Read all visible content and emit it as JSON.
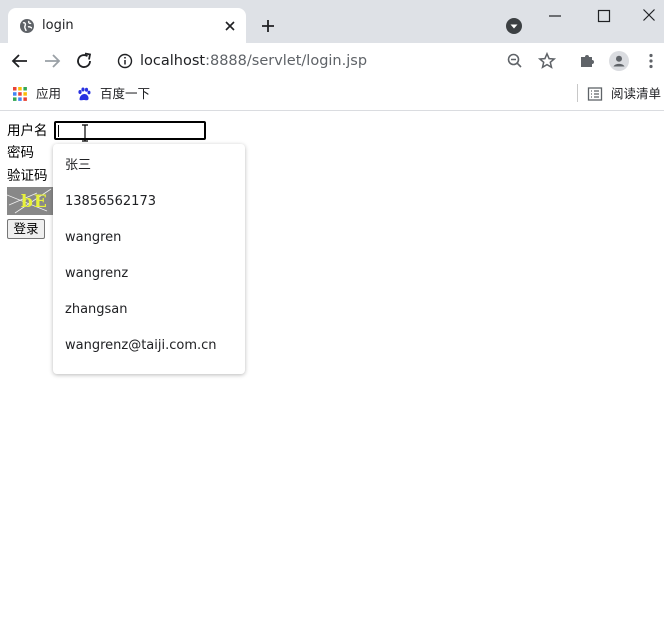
{
  "browser": {
    "tab": {
      "title": "login",
      "favicon": "globe-icon"
    },
    "address": {
      "host": "localhost",
      "path": ":8888/servlet/login.jsp"
    },
    "bookmarks": [
      {
        "label": "应用",
        "icon": "apps-grid-icon"
      },
      {
        "label": "百度一下",
        "icon": "baidu-paw-icon"
      }
    ],
    "reading_list": {
      "label": "阅读清单",
      "icon": "reading-list-icon"
    }
  },
  "form": {
    "username_label": "用户名",
    "username_value": "",
    "password_label": "密码",
    "captcha_label": "验证码",
    "captcha_text": "bE",
    "login_button": "登录"
  },
  "autocomplete": {
    "suggestions": [
      "张三",
      "13856562173",
      "wangren",
      "wangrenz",
      "zhangsan",
      "wangrenz@taiji.com.cn"
    ]
  },
  "colors": {
    "tabstrip": "#dee1e6",
    "captcha_bg": "#888888",
    "captcha_text": "#e8f23a"
  }
}
